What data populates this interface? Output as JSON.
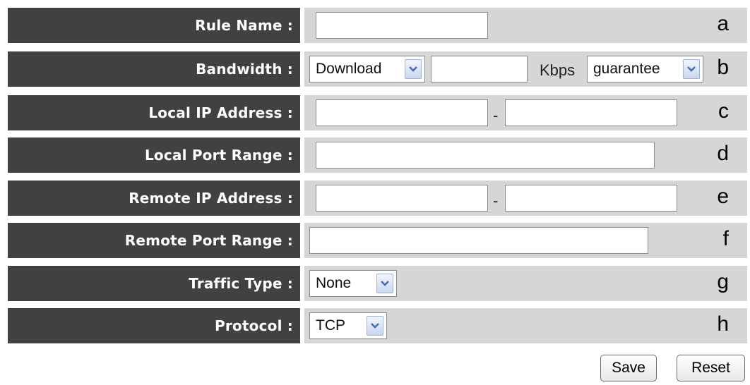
{
  "rows": {
    "rule_name": {
      "label": "Rule Name :",
      "value": "",
      "letter": "a"
    },
    "bandwidth": {
      "label": "Bandwidth :",
      "direction": "Download",
      "value": "",
      "unit": "Kbps",
      "mode": "guarantee",
      "letter": "b"
    },
    "local_ip": {
      "label": "Local IP Address :",
      "from": "",
      "separator": "-",
      "to": "",
      "letter": "c"
    },
    "local_port": {
      "label": "Local Port Range :",
      "value": "",
      "letter": "d"
    },
    "remote_ip": {
      "label": "Remote IP Address :",
      "from": "",
      "separator": "-",
      "to": "",
      "letter": "e"
    },
    "remote_port": {
      "label": "Remote Port Range :",
      "value": "",
      "letter": "f"
    },
    "traffic_type": {
      "label": "Traffic Type :",
      "value": "None",
      "letter": "g"
    },
    "protocol": {
      "label": "Protocol :",
      "value": "TCP",
      "letter": "h"
    }
  },
  "buttons": {
    "save": "Save",
    "reset": "Reset"
  },
  "icons": {
    "dropdown": "chevron-down-icon"
  },
  "colors": {
    "label_bg": "#414141",
    "value_bg": "#d6d6d6",
    "arrow_color": "#4a6fb3"
  }
}
